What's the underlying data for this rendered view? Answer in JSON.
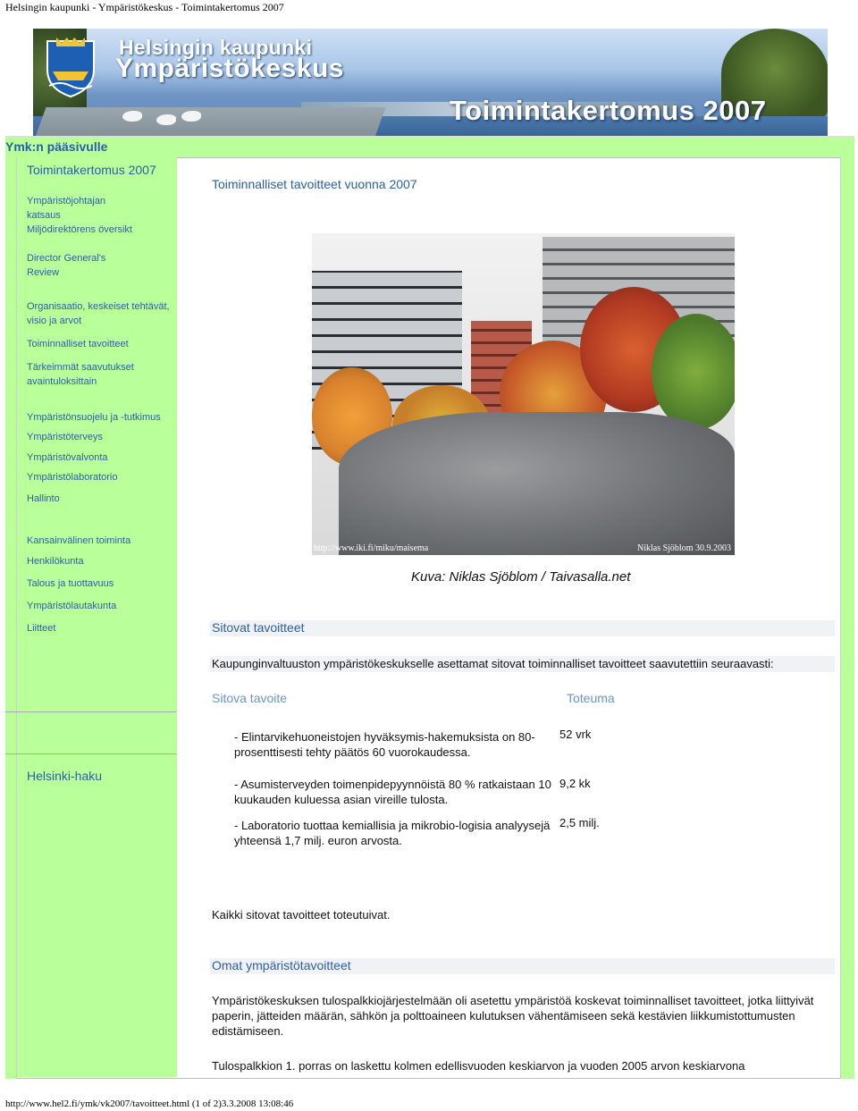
{
  "window": {
    "doc_title": "Helsingin kaupunki - Ympäristökeskus - Toimintakertomus 2007",
    "footer_url": "http://www.hel2.fi/ymk/vk2007/tavoitteet.html (1 of 2)3.3.2008 13:08:46"
  },
  "banner": {
    "org_line1": "Helsingin kaupunki",
    "org_line2": "Ympäristökeskus",
    "report_title": "Toimintakertomus 2007"
  },
  "nav": {
    "home_link": "Ymk:n pääsivulle"
  },
  "sidebar": {
    "section_title": "Toimintakertomus  2007",
    "items": [
      "Ympäristöjohtajan katsaus",
      "Miljödirektörens översikt",
      "Director General's Review",
      "Organisaatio, keskeiset tehtävät, visio ja arvot",
      "Toiminnalliset tavoitteet",
      "Tärkeimmät saavutukset avaintuloksittain",
      "Ympäristönsuojelu ja -tutkimus",
      "Ympäristöterveys",
      "Ympäristövalvonta",
      "Ympäristölaboratorio",
      "Hallinto",
      "Kansainvälinen toiminta",
      "Henkilökunta",
      "Talous ja tuottavuus",
      "Ympäristölautakunta",
      "Liitteet"
    ],
    "search_link": "Helsinki-haku"
  },
  "main": {
    "page_title": "Toiminnalliset tavoitteet vuonna 2007",
    "photo": {
      "caption_left": "http://www.iki.fi/miku/maisema",
      "caption_right": "Niklas Sjöblom 30.9.2003",
      "credit": "Kuva: Niklas Sjöblom / Taivasalla.net"
    },
    "binding": {
      "heading": "Sitovat tavoitteet",
      "intro": "Kaupunginvaltuuston ympäristökeskukselle asettamat sitovat toiminnalliset tavoitteet saavutettiin seuraavasti:",
      "col_goal": "Sitova tavoite",
      "col_result": "Toteuma",
      "goals": [
        {
          "text": "-   Elintarvikehuoneistojen hyväksymis-hakemuksista on 80-prosenttisesti tehty päätös 60 vuorokaudessa.",
          "result": "52 vrk"
        },
        {
          "text": "-    Asumisterveyden toimenpidepyynnöistä 80 % ratkaistaan 10 kuukauden kuluessa asian vireille tulosta.",
          "result": "9,2 kk"
        },
        {
          "text": "-   Laboratorio tuottaa kemiallisia ja mikrobio-logisia analyysejä yhteensä 1,7 milj. euron arvosta.",
          "result": "2,5 milj."
        }
      ],
      "summary": "Kaikki sitovat tavoitteet toteutuivat."
    },
    "own": {
      "heading": "Omat ympäristötavoitteet",
      "paragraph": "Ympäristökeskuksen tulospalkkiojärjestelmään oli asetettu ympäristöä koskevat toiminnalliset tavoitteet, jotka liittyivät paperin, jätteiden määrän, sähkön ja polttoaineen kulutuksen vähentämiseen sekä kestävien liikkumistottumusten edistämiseen.",
      "paragraph2": "Tulospalkkion 1. porras on laskettu kolmen edellisvuoden keskiarvon ja vuoden 2005 arvon keskiarvona"
    }
  },
  "colors": {
    "link_blue": "#2a5fa8",
    "sidebar_green": "#b9ff9a",
    "goal_header_blue": "#6a95cf"
  }
}
